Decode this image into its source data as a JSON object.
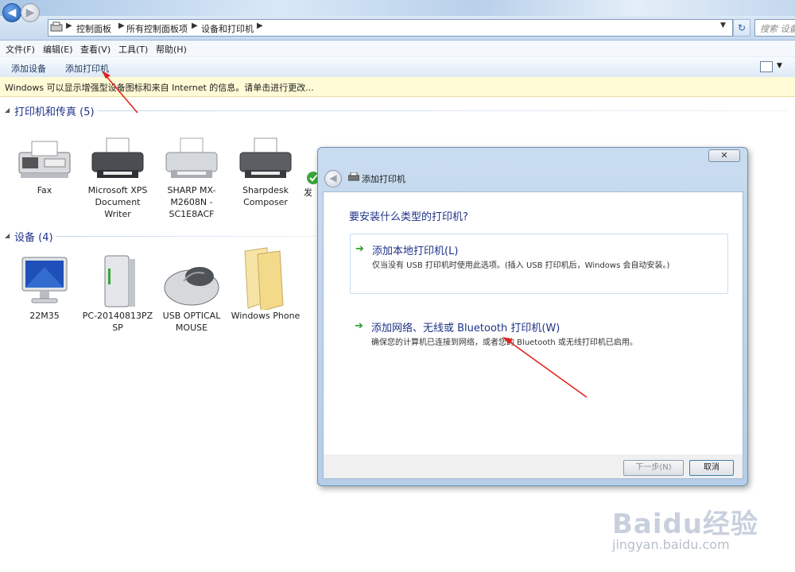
{
  "window": {
    "breadcrumb": [
      "控制面板",
      "所有控制面板项",
      "设备和打印机"
    ],
    "search_placeholder": "搜索 设备"
  },
  "menu": [
    "文件(F)",
    "编辑(E)",
    "查看(V)",
    "工具(T)",
    "帮助(H)"
  ],
  "commands": {
    "add_device": "添加设备",
    "add_printer": "添加打印机"
  },
  "infobar": "Windows 可以显示增强型设备图标和来自 Internet 的信息。请单击进行更改...",
  "printers_group": {
    "title": "打印机和传真 (5)",
    "items": [
      {
        "label": "Fax",
        "icon": "fax-icon"
      },
      {
        "label": "Microsoft XPS Document Writer",
        "icon": "printer-icon"
      },
      {
        "label": "SHARP MX-M2608N - SC1E8ACF",
        "icon": "printer-icon"
      },
      {
        "label": "Sharpdesk Composer",
        "icon": "printer-icon"
      },
      {
        "label": "发",
        "icon": "default-printer-icon"
      }
    ]
  },
  "devices_group": {
    "title": "设备 (4)",
    "items": [
      {
        "label": "22M35",
        "icon": "monitor-icon"
      },
      {
        "label": "PC-20140813PZSP",
        "icon": "computer-tower-icon"
      },
      {
        "label": "USB OPTICAL MOUSE",
        "icon": "mouse-icon"
      },
      {
        "label": "Windows Phone",
        "icon": "folder-icon"
      }
    ]
  },
  "dialog": {
    "title": "添加打印机",
    "close": "✕",
    "question": "要安装什么类型的打印机?",
    "options": [
      {
        "title": "添加本地打印机(L)",
        "desc": "仅当没有 USB 打印机时使用此选项。(插入 USB 打印机后，Windows 会自动安装。)"
      },
      {
        "title": "添加网络、无线或 Bluetooth 打印机(W)",
        "desc": "确保您的计算机已连接到网络，或者您的 Bluetooth 或无线打印机已启用。"
      }
    ],
    "next_button": "下一步(N)",
    "cancel_button": "取消"
  },
  "watermark": {
    "logo": "Baidu经验",
    "url": "jingyan.baidu.com"
  },
  "colors": {
    "accent": "#1e3287",
    "annotation_arrow": "#e0201a",
    "infobar_bg": "#fffbd6"
  }
}
